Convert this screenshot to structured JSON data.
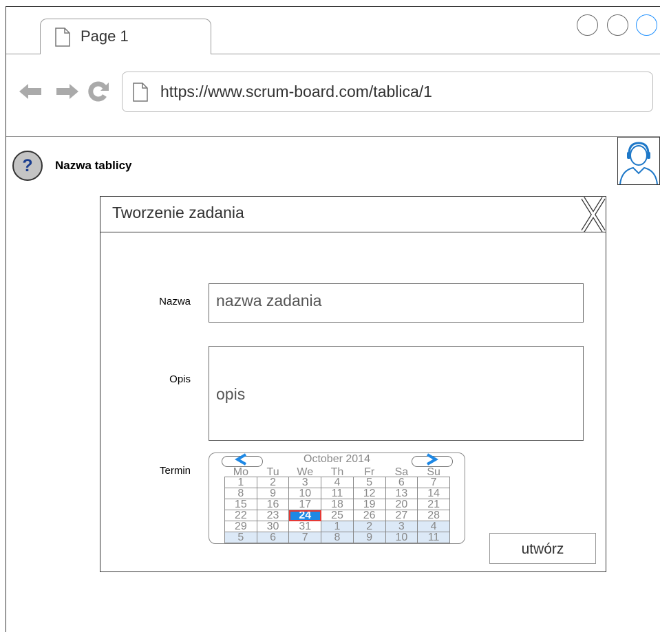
{
  "browser": {
    "tab_label": "Page 1",
    "url": "https://www.scrum-board.com/tablica/1"
  },
  "header": {
    "help_symbol": "?",
    "board_name": "Nazwa tablicy"
  },
  "dialog": {
    "title": "Tworzenie zadania",
    "name_label": "Nazwa",
    "name_value": "nazwa zadania",
    "description_label": "Opis",
    "description_value": "opis",
    "deadline_label": "Termin",
    "create_button": "utwórz"
  },
  "calendar": {
    "month": "October 2014",
    "weekdays": [
      "Mo",
      "Tu",
      "We",
      "Th",
      "Fr",
      "Sa",
      "Su"
    ],
    "selected_day": "24",
    "weeks": [
      [
        "1",
        "2",
        "3",
        "4",
        "5",
        "6",
        "7"
      ],
      [
        "8",
        "9",
        "10",
        "11",
        "12",
        "13",
        "14"
      ],
      [
        "15",
        "16",
        "17",
        "18",
        "19",
        "20",
        "21"
      ],
      [
        "22",
        "23",
        "24",
        "25",
        "26",
        "27",
        "28"
      ],
      [
        "29",
        "30",
        "31",
        "1",
        "2",
        "3",
        "4"
      ],
      [
        "5",
        "6",
        "7",
        "8",
        "9",
        "10",
        "11"
      ]
    ],
    "other_month_from": {
      "week": 4,
      "day": 3
    },
    "colors": {
      "selected": "#1e88e5",
      "selected_border": "#e53935",
      "other_month": "#dce9f7",
      "nav_arrows": "#1e88e5"
    }
  },
  "icons": {
    "back": "arrow-left-icon",
    "forward": "arrow-right-icon",
    "reload": "reload-icon",
    "page": "document-icon",
    "user": "user-avatar-icon",
    "close": "close-icon"
  }
}
